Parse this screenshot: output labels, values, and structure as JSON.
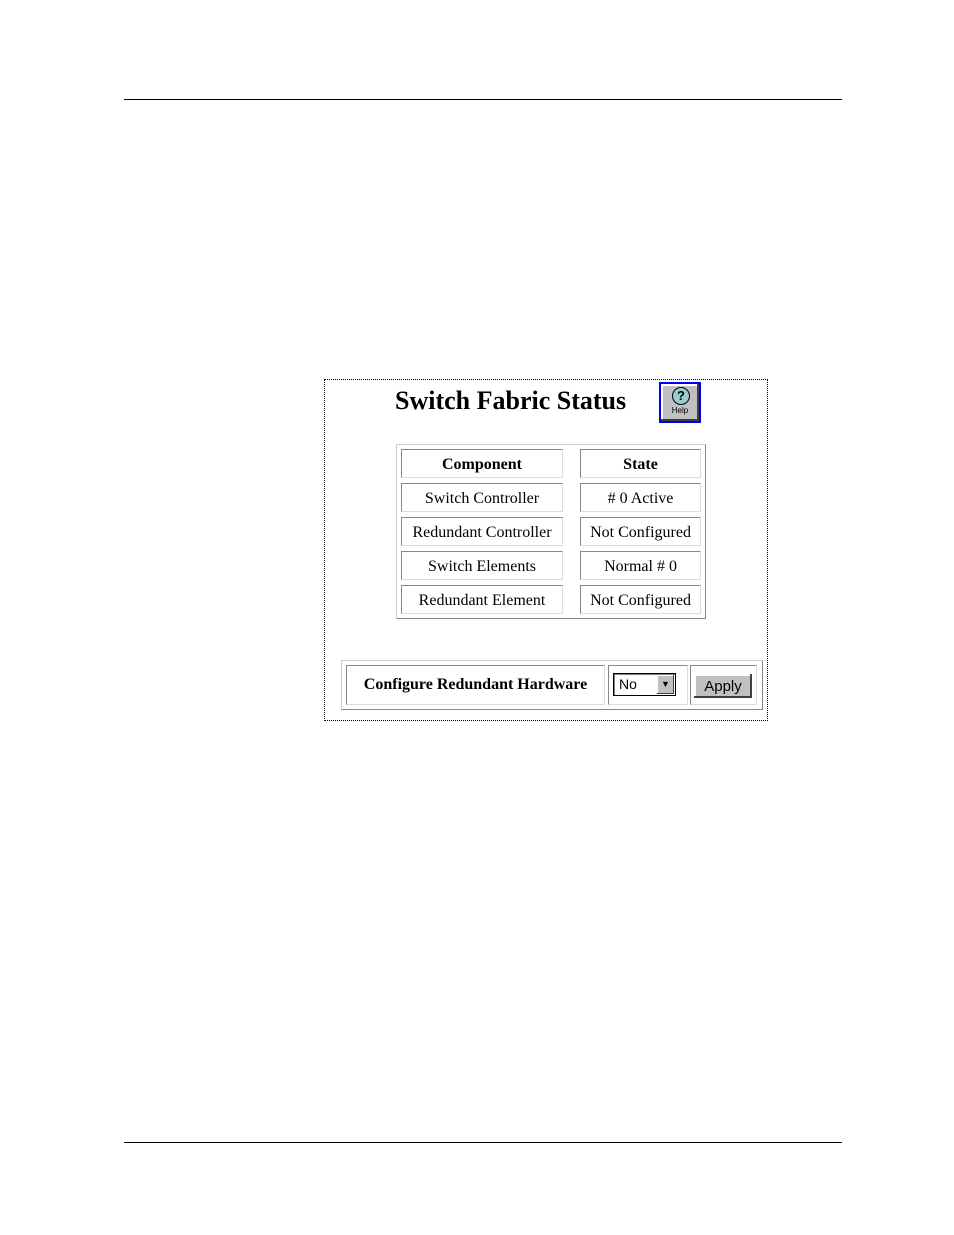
{
  "title": "Switch Fabric Status",
  "help": {
    "label": "Help",
    "icon": "help-icon"
  },
  "status_table": {
    "headers": [
      "Component",
      "State"
    ],
    "rows": [
      [
        "Switch Controller",
        "# 0 Active"
      ],
      [
        "Redundant Controller",
        "Not Configured"
      ],
      [
        "Switch Elements",
        "Normal # 0"
      ],
      [
        "Redundant Element",
        "Not Configured"
      ]
    ]
  },
  "config": {
    "label": "Configure Redundant Hardware",
    "select_value": "No",
    "apply_label": "Apply"
  }
}
